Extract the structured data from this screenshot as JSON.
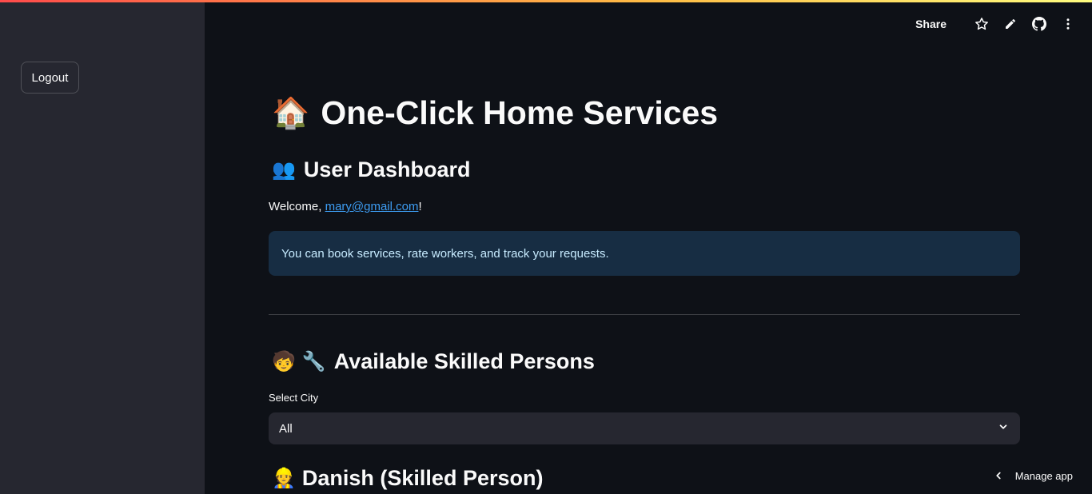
{
  "toolbar": {
    "share_label": "Share",
    "icons": [
      "star-icon",
      "edit-icon",
      "github-icon",
      "more-vertical-icon"
    ]
  },
  "sidebar": {
    "logout_label": "Logout"
  },
  "main": {
    "title_emoji": "🏠",
    "title_text": "One-Click Home Services",
    "dashboard_emoji": "👥",
    "dashboard_text": "User Dashboard",
    "welcome_prefix": "Welcome, ",
    "welcome_email": "mary@gmail.com",
    "welcome_suffix": "!",
    "info_text": "You can book services, rate workers, and track your requests.",
    "skilled_emoji_1": "🧒",
    "skilled_emoji_2": "🔧",
    "skilled_text": "Available Skilled Persons",
    "city_label": "Select City",
    "city_selected": "All",
    "worker_emoji": "👷",
    "worker_text": "Danish (Skilled Person)"
  },
  "footer": {
    "manage_label": "Manage app"
  },
  "colors": {
    "background": "#0e1117",
    "sidebar": "#262730",
    "info_bg": "#172d43",
    "info_text": "#c7ebff",
    "link": "#3d9df3"
  }
}
